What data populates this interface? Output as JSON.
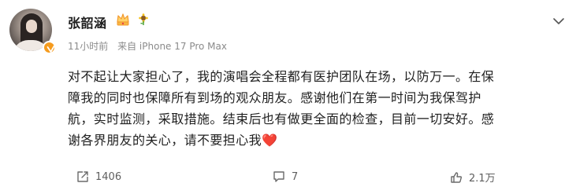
{
  "user": {
    "name": "张韶涵",
    "time": "11小时前",
    "source": "来自 iPhone 17 Pro Max"
  },
  "post": {
    "text": "对不起让大家担心了，我的演唱会全程都有医护团队在场，以防万一。在保障我的同时也保障所有到场的观众朋友。感谢他们在第一时间为我保驾护航，实时监测，采取措施。结束后也有做更全面的检查，目前一切安好。感谢各界朋友的关心，请不要担心我",
    "emoji": "❤️"
  },
  "actions": {
    "share_count": "1406",
    "comment_count": "7",
    "like_count": "2.1万"
  },
  "colors": {
    "verified_badge": "#f59b1e",
    "heart": "#e8414a"
  }
}
